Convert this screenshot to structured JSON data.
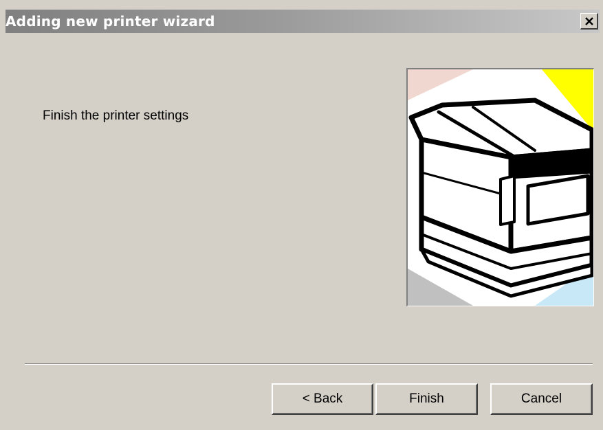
{
  "window": {
    "title": "Adding new printer wizard",
    "close_icon": "close-icon"
  },
  "content": {
    "instruction": "Finish the printer settings",
    "illustration_icon": "printer-icon"
  },
  "buttons": {
    "back_label": "< Back",
    "finish_label": "Finish",
    "cancel_label": "Cancel"
  },
  "colors": {
    "titlebar_start": "#808080",
    "titlebar_end": "#c8c8c8",
    "dialog_background": "#d4d0c8",
    "corner_yellow": "#ffff00",
    "corner_pink": "#f0d8d0",
    "corner_blue": "#c8e8f8",
    "corner_gray": "#c0c0c0"
  }
}
